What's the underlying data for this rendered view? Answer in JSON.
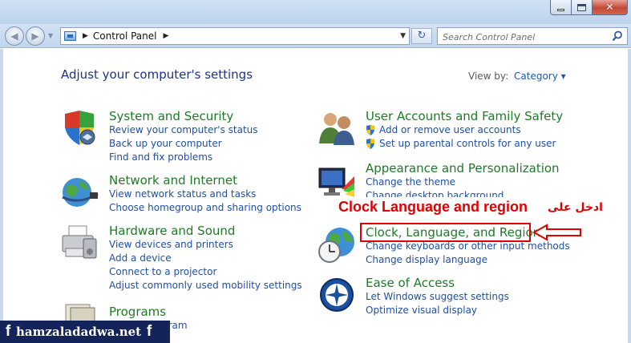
{
  "window": {
    "minimize": "minimize",
    "maximize": "maximize",
    "close": "close"
  },
  "address_bar": {
    "crumb": "Control Panel"
  },
  "search": {
    "placeholder": "Search Control Panel"
  },
  "main": {
    "heading": "Adjust your computer's settings",
    "view_by_label": "View by:",
    "view_by_value": "Category ▾"
  },
  "categories": {
    "system": {
      "title": "System and Security",
      "links": [
        "Review your computer's status",
        "Back up your computer",
        "Find and fix problems"
      ]
    },
    "network": {
      "title": "Network and Internet",
      "links": [
        "View network status and tasks",
        "Choose homegroup and sharing options"
      ]
    },
    "hardware": {
      "title": "Hardware and Sound",
      "links": [
        "View devices and printers",
        "Add a device",
        "Connect to a projector",
        "Adjust commonly used mobility settings"
      ]
    },
    "programs": {
      "title": "Programs",
      "links": [
        "gram"
      ]
    },
    "accounts": {
      "title": "User Accounts and Family Safety",
      "links": [
        "Add or remove user accounts",
        "Set up parental controls for any user"
      ]
    },
    "appearance": {
      "title": "Appearance and Personalization",
      "links": [
        "Change the theme",
        "Change desktop background"
      ]
    },
    "clock": {
      "title": "Clock, Language, and Region",
      "links": [
        "Change keyboards or other input methods",
        "Change display language"
      ]
    },
    "ease": {
      "title": "Ease of Access",
      "links": [
        "Let Windows suggest settings",
        "Optimize visual display"
      ]
    }
  },
  "annotation": {
    "text": "Clock Language and region",
    "arabic": "ادخل على"
  },
  "watermark": {
    "text": "hamzaladadwa.net",
    "fb": "f"
  },
  "colors": {
    "title_green": "#1e7a26",
    "link_blue": "#1f4fa5",
    "heading_blue": "#1e3287",
    "annotation_red": "#e00000"
  }
}
